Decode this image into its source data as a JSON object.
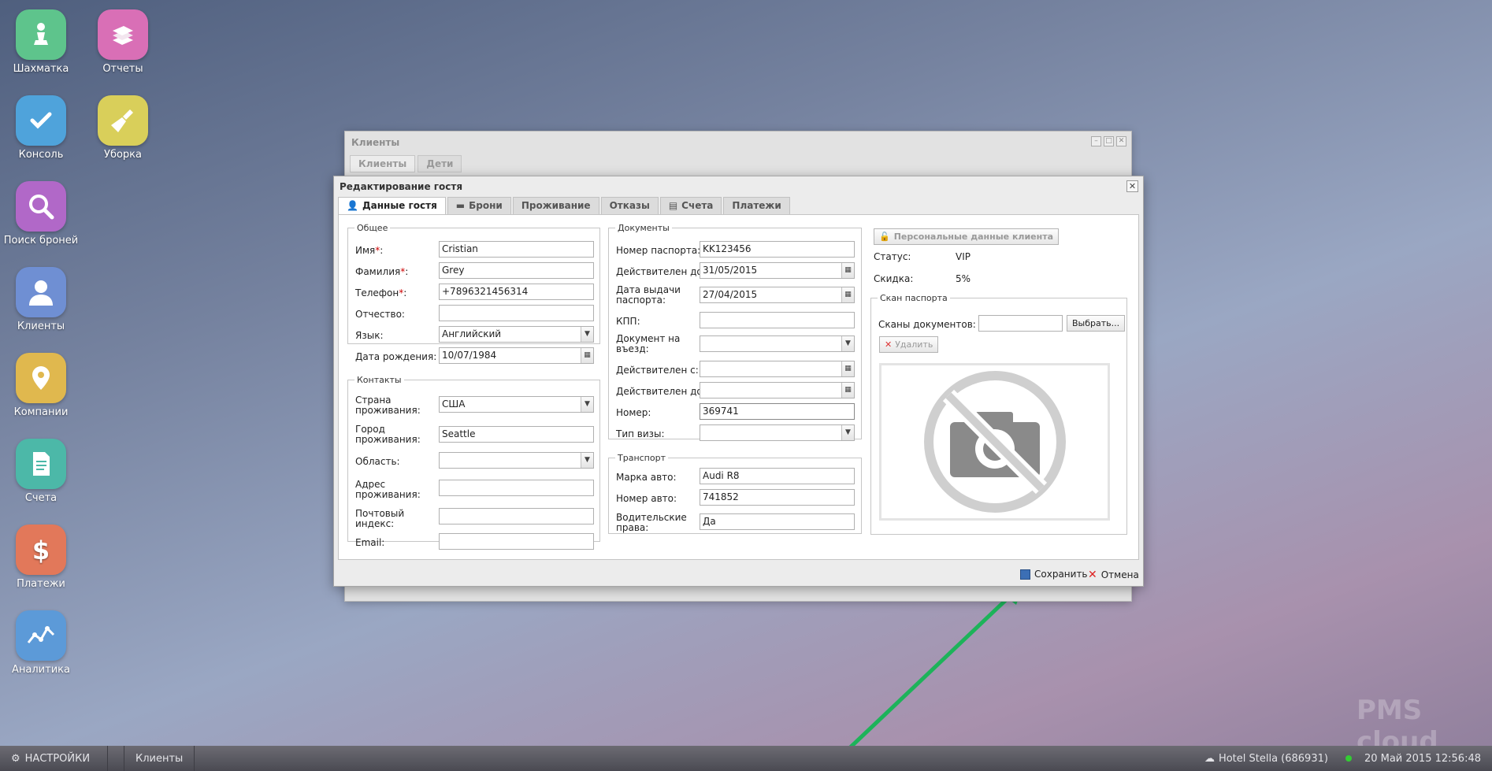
{
  "desktop": [
    {
      "label": "Шахматка",
      "icon": "chess-pawn-icon",
      "color": "#5ec48c"
    },
    {
      "label": "Отчеты",
      "icon": "books-icon",
      "color": "#d96fb6"
    },
    {
      "label": "Консоль",
      "icon": "checkmark-icon",
      "color": "#4fa3db"
    },
    {
      "label": "Уборка",
      "icon": "broom-icon",
      "color": "#d9cf5a"
    },
    {
      "label": "Поиск броней",
      "icon": "magnifier-icon",
      "color": "#b168c8"
    },
    {
      "label": "Клиенты",
      "icon": "person-icon",
      "color": "#6f8fd3"
    },
    {
      "label": "Компании",
      "icon": "map-pin-icon",
      "color": "#e0b84e"
    },
    {
      "label": "Счета",
      "icon": "document-icon",
      "color": "#4cb8a8"
    },
    {
      "label": "Платежи",
      "icon": "dollar-icon",
      "color": "#e2785a"
    },
    {
      "label": "Аналитика",
      "icon": "line-chart-icon",
      "color": "#5c9ad8"
    }
  ],
  "bg_window": {
    "title": "Клиенты",
    "tabs": [
      "Клиенты",
      "Дети"
    ]
  },
  "dialog": {
    "title": "Редактирование гостя",
    "tabs": [
      "Данные гостя",
      "Брони",
      "Проживание",
      "Отказы",
      "Счета",
      "Платежи"
    ],
    "general": {
      "legend": "Общее",
      "first_name_label": "Имя",
      "first_name": "Cristian",
      "last_name_label": "Фамилия",
      "last_name": "Grey",
      "phone_label": "Телефон",
      "phone": "+7896321456314",
      "patronymic_label": "Отчество",
      "patronymic": "",
      "language_label": "Язык:",
      "language": "Английский",
      "birth_label": "Дата рождения:",
      "birth": "10/07/1984"
    },
    "contacts": {
      "legend": "Контакты",
      "country_label": "Страна проживания:",
      "country": "США",
      "city_label": "Город проживания:",
      "city": "Seattle",
      "region_label": "Область:",
      "region": "",
      "address_label": "Адрес проживания:",
      "address": "",
      "zip_label": "Почтовый индекс:",
      "zip": "",
      "email_label": "Email:",
      "email": ""
    },
    "documents": {
      "legend": "Документы",
      "passport_label": "Номер паспорта:",
      "passport": "KK123456",
      "valid_to_label": "Действителен до:",
      "valid_to": "31/05/2015",
      "issue_label": "Дата выдачи паспорта:",
      "issue": "27/04/2015",
      "kpp_label": "КПП:",
      "kpp": "",
      "entry_doc_label": "Документ на въезд:",
      "entry_doc": "",
      "valid_from2_label": "Действителен с:",
      "valid_from2": "",
      "valid_to2_label": "Действителен до:",
      "valid_to2": "",
      "number_label": "Номер:",
      "number": "369741",
      "visa_label": "Тип визы:",
      "visa": ""
    },
    "transport": {
      "legend": "Транспорт",
      "car_label": "Марка авто:",
      "car": "Audi R8",
      "plate_label": "Номер авто:",
      "plate": "741852",
      "license_label": "Водительские права:",
      "license": "Да"
    },
    "personal_btn": "Персональные данные клиента",
    "status_label": "Статус:",
    "status": "VIP",
    "discount_label": "Скидка:",
    "discount": "5%",
    "scan": {
      "legend": "Скан паспорта",
      "docs_label": "Сканы документов:",
      "choose": "Выбрать...",
      "delete": "Удалить"
    },
    "save": "Сохранить",
    "cancel": "Отмена"
  },
  "taskbar": {
    "settings": "НАСТРОЙКИ",
    "task": "Клиенты",
    "hotel": "Hotel Stella (686931)",
    "datetime": "20 Май 2015 12:56:48"
  },
  "watermark": "PMS cloud",
  "colors": {
    "arrow": "#1db35a",
    "accent_required": "#cc0000"
  }
}
